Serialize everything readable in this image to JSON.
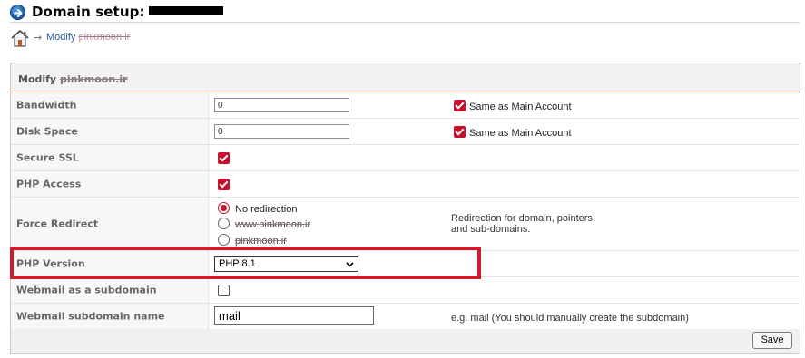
{
  "header": {
    "title": "Domain setup:",
    "icon": "arrow-right-circle-icon"
  },
  "breadcrumb": {
    "home_icon": "home-icon",
    "separator": "→",
    "link_label": "Modify",
    "link_domain": "pinkmoon.ir"
  },
  "panel": {
    "title_prefix": "Modify",
    "title_domain": "pinkmoon.ir"
  },
  "rows": {
    "bandwidth": {
      "label": "Bandwidth",
      "value": "0",
      "same_label": "Same as Main Account",
      "same_checked": true
    },
    "disk_space": {
      "label": "Disk Space",
      "value": "0",
      "same_label": "Same as Main Account",
      "same_checked": true
    },
    "secure_ssl": {
      "label": "Secure SSL",
      "checked": true
    },
    "php_access": {
      "label": "PHP Access",
      "checked": true
    },
    "force_redirect": {
      "label": "Force Redirect",
      "options": [
        {
          "label": "No redirection",
          "selected": true
        },
        {
          "label": "www.pinkmoon.ir",
          "selected": false
        },
        {
          "label": "pinkmoon.ir",
          "selected": false
        }
      ],
      "note_line1": "Redirection for domain, pointers,",
      "note_line2": "and sub-domains."
    },
    "php_version": {
      "label": "PHP Version",
      "selected": "PHP 8.1"
    },
    "webmail_subdomain": {
      "label": "Webmail as a subdomain",
      "checked": false
    },
    "webmail_name": {
      "label": "Webmail subdomain name",
      "value": "mail",
      "note": "e.g. mail (You should manually create the subdomain)"
    }
  },
  "footer": {
    "save_label": "Save"
  },
  "colors": {
    "accent_red": "#c8102e",
    "highlight_box": "#c8202a",
    "header_rule": "#c86a2e",
    "link_blue": "#2a5d9a"
  }
}
